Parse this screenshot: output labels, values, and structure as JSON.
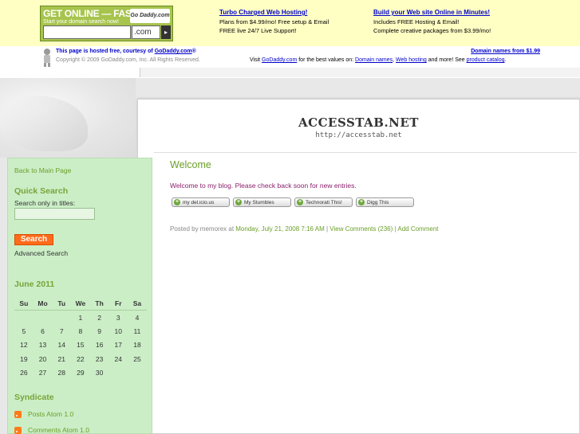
{
  "top_ad": {
    "godaddy": {
      "headline": "GET ONLINE — FAST!",
      "subline": "Start your domain search now!",
      "logo": "Go Daddy.com",
      "search_value": "",
      "tld": ".com"
    },
    "ad1": {
      "title": "Turbo Charged Web Hosting!",
      "line1": "Plans from $4.99/mo! Free setup & Email",
      "line2": "FREE live 24/7 Live Support!"
    },
    "ad2": {
      "title": "Build your Web site Online in Minutes!",
      "line1": "Includes FREE Hosting & Email!",
      "line2": "Complete creative packages from $3.99/mo!"
    }
  },
  "hosted": {
    "line1_prefix": "This page is hosted free, courtesy of ",
    "line1_link": "GoDaddy.com",
    "line1_suffix": "®",
    "line2": "Copyright © 2009 GoDaddy.com, Inc. All Rights Reserved.",
    "right_link": "Domain names from $1.99",
    "right2_prefix": "Visit ",
    "right2_link1": "GoDaddy.com",
    "right2_mid": " for the best values on: ",
    "right2_link2": "Domain names",
    "right2_sep": ", ",
    "right2_link3": "Web hosting",
    "right2_mid2": " and more! See ",
    "right2_link4": "product catalog",
    "right2_end": "."
  },
  "blog": {
    "title": "ACCESSTAB.NET",
    "url": "http://accesstab.net"
  },
  "post": {
    "title": "Welcome",
    "body": "Welcome to my blog. Please check back soon for new entries.",
    "bookmarks": [
      "my del.icio.us",
      "My Stumbles",
      "Technorati This!",
      "Digg This"
    ],
    "meta_prefix": "Posted by memorex at ",
    "meta_date": "Monday, July 21, 2008 7:16 AM",
    "meta_sep1": " | ",
    "meta_comments": "View Comments (236)",
    "meta_sep2": " | ",
    "meta_add": "Add Comment"
  },
  "sidebar": {
    "back_link": "Back to Main Page",
    "quick_search_heading": "Quick Search",
    "quick_search_label": "Search only in titles:",
    "quick_search_value": "",
    "search_button": "Search",
    "advanced_search": "Advanced Search",
    "calendar": {
      "heading": "June 2011",
      "days": [
        "Su",
        "Mo",
        "Tu",
        "We",
        "Th",
        "Fr",
        "Sa"
      ],
      "weeks": [
        [
          "",
          "",
          "",
          "1",
          "2",
          "3",
          "4"
        ],
        [
          "5",
          "6",
          "7",
          "8",
          "9",
          "10",
          "11"
        ],
        [
          "12",
          "13",
          "14",
          "15",
          "16",
          "17",
          "18"
        ],
        [
          "19",
          "20",
          "21",
          "22",
          "23",
          "24",
          "25"
        ],
        [
          "26",
          "27",
          "28",
          "29",
          "30",
          "",
          ""
        ]
      ]
    },
    "syndicate_heading": "Syndicate",
    "feeds": [
      "Posts Atom 1.0",
      "Comments Atom 1.0"
    ]
  },
  "colors": {
    "accent_green": "#6b9f2a",
    "sidebar_bg": "#cbeec6",
    "post_body": "#8a1f6b",
    "search_button": "#ff6b1a",
    "ad_banner_bg": "#ffffc4"
  }
}
